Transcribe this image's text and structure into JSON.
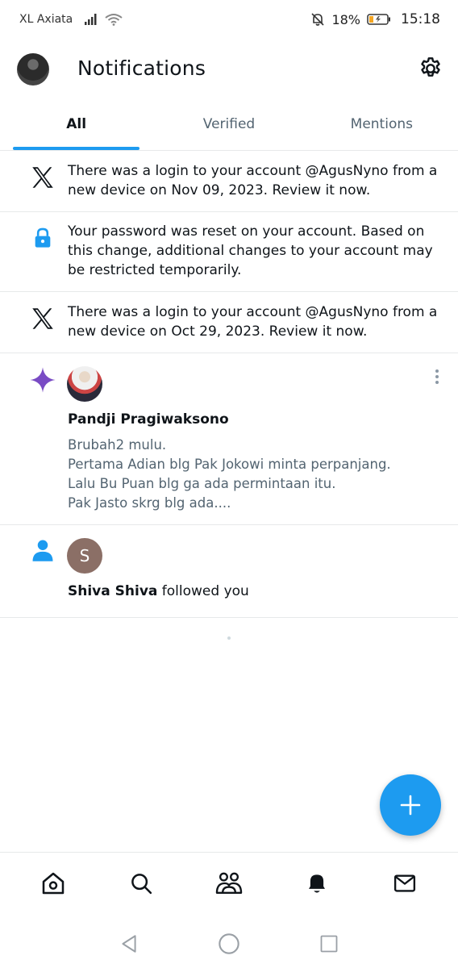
{
  "status_bar": {
    "carrier": "XL Axiata",
    "battery_percent": "18%",
    "time": "15:18",
    "icons": [
      "signal-icon",
      "wifi-icon",
      "mute-bell-icon",
      "battery-icon"
    ]
  },
  "header": {
    "title": "Notifications",
    "icons": [
      "avatar",
      "gear-icon"
    ]
  },
  "tabs": [
    {
      "label": "All",
      "active": true
    },
    {
      "label": "Verified",
      "active": false
    },
    {
      "label": "Mentions",
      "active": false
    }
  ],
  "notifications": [
    {
      "icon": "x-logo-icon",
      "text_lines": [
        "There was a login to your account @AgusNyno from a",
        "new device on Nov 09, 2023. Review it now."
      ]
    },
    {
      "icon": "lock-icon",
      "text_lines": [
        "Your password was reset on your account. Based on",
        "this change, additional changes to your account may",
        "be restricted temporarily."
      ]
    },
    {
      "icon": "x-logo-icon",
      "text_lines": [
        "There was a login to your account @AgusNyno from a",
        "new device on Oct 29, 2023. Review it now."
      ]
    },
    {
      "icon": "sparkle-icon",
      "name": "Pandji Pragiwaksono",
      "quote_lines": [
        "Brubah2 mulu.",
        "Pertama Adian blg Pak Jokowi minta perpanjang.",
        "Lalu Bu Puan blg ga ada permintaan itu.",
        "Pak Jasto skrg blg ada...."
      ]
    },
    {
      "icon": "person-icon",
      "avatar_letter": "S",
      "name": "Shiva Shiva",
      "action": " followed you"
    }
  ],
  "colors": {
    "accent": "#1d9bf0",
    "sparkle": "#794bc4",
    "text_primary": "#0f1419",
    "text_secondary": "#536471",
    "divider": "#e7e9ea"
  },
  "bottom_nav": [
    "home-icon",
    "search-icon",
    "communities-icon",
    "notifications-bell-icon",
    "messages-icon"
  ],
  "system_nav": [
    "back-icon",
    "home-circle-icon",
    "recents-icon"
  ],
  "fab": {
    "icon": "plus-icon"
  }
}
